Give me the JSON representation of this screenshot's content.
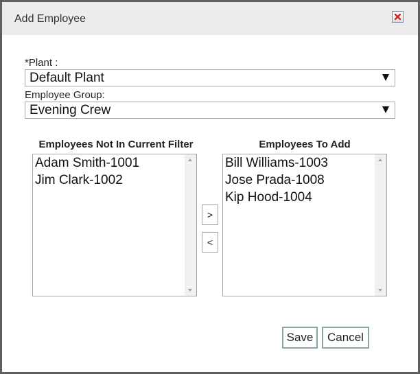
{
  "dialog": {
    "title": "Add Employee",
    "close_icon": "close-x-icon"
  },
  "form": {
    "plant": {
      "label": "*Plant :",
      "value": "Default Plant"
    },
    "employee_group": {
      "label": "Employee Group:",
      "value": "Evening Crew"
    }
  },
  "lists": {
    "not_in_filter": {
      "heading": "Employees Not In Current Filter",
      "items": [
        "Adam Smith-1001",
        "Jim Clark-1002"
      ]
    },
    "to_add": {
      "heading": "Employees To Add",
      "items": [
        "Bill Williams-1003",
        "Jose Prada-1008",
        "Kip Hood-1004"
      ]
    }
  },
  "move_buttons": {
    "add": ">",
    "remove": "<"
  },
  "actions": {
    "save": "Save",
    "cancel": "Cancel"
  },
  "colors": {
    "close_x": "#c0282a",
    "titlebar_bg": "#ececec",
    "button_border": "#8da5a8"
  }
}
